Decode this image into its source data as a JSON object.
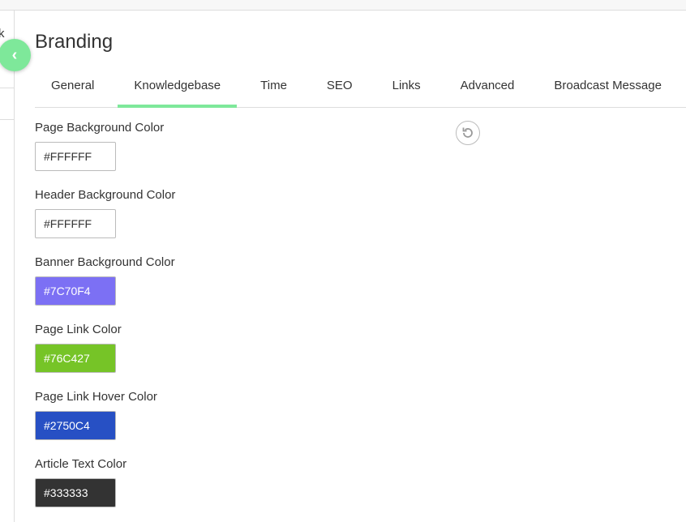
{
  "sidebar": {
    "partial_text": "k"
  },
  "page_title": "Branding",
  "tabs": [
    {
      "label": "General"
    },
    {
      "label": "Knowledgebase",
      "active": true
    },
    {
      "label": "Time"
    },
    {
      "label": "SEO"
    },
    {
      "label": "Links"
    },
    {
      "label": "Advanced"
    },
    {
      "label": "Broadcast Message"
    }
  ],
  "fields": [
    {
      "label": "Page Background Color",
      "value": "#FFFFFF",
      "bg": "#FFFFFF",
      "fg": "#333333"
    },
    {
      "label": "Header Background Color",
      "value": "#FFFFFF",
      "bg": "#FFFFFF",
      "fg": "#333333"
    },
    {
      "label": "Banner Background Color",
      "value": "#7C70F4",
      "bg": "#7C70F4",
      "fg": "#FFFFFF"
    },
    {
      "label": "Page Link Color",
      "value": "#76C427",
      "bg": "#76C427",
      "fg": "#FFFFFF"
    },
    {
      "label": "Page Link Hover Color",
      "value": "#2750C4",
      "bg": "#2750C4",
      "fg": "#FFFFFF"
    },
    {
      "label": "Article Text Color",
      "value": "#333333",
      "bg": "#333333",
      "fg": "#FFFFFF"
    }
  ],
  "accent": "#7EE89A"
}
